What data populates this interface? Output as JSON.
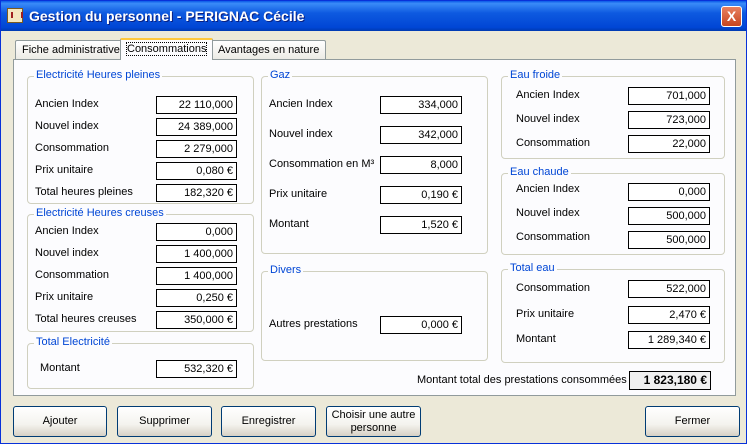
{
  "window": {
    "title": "Gestion du personnel - PERIGNAC Cécile",
    "close_label": "X"
  },
  "tabs": [
    {
      "label": "Fiche administrative"
    },
    {
      "label": "Consommations"
    },
    {
      "label": "Avantages en nature"
    }
  ],
  "hp": {
    "title": "Electricité Heures pleines",
    "ancien_label": "Ancien Index",
    "ancien": "22 110,000",
    "nouvel_label": "Nouvel index",
    "nouvel": "24 389,000",
    "conso_label": "Consommation",
    "conso": "2 279,000",
    "prix_label": "Prix unitaire",
    "prix": "0,080 €",
    "total_label": "Total heures pleines",
    "total": "182,320 €"
  },
  "hc": {
    "title": "Electricité Heures creuses",
    "ancien_label": "Ancien Index",
    "ancien": "0,000",
    "nouvel_label": "Nouvel index",
    "nouvel": "1 400,000",
    "conso_label": "Consommation",
    "conso": "1 400,000",
    "prix_label": "Prix unitaire",
    "prix": "0,250 €",
    "total_label": "Total heures creuses",
    "total": "350,000 €"
  },
  "te": {
    "title": "Total Electricité",
    "montant_label": "Montant",
    "montant": "532,320 €"
  },
  "gaz": {
    "title": "Gaz",
    "ancien_label": "Ancien Index",
    "ancien": "334,000",
    "nouvel_label": "Nouvel index",
    "nouvel": "342,000",
    "conso_label": "Consommation en M³",
    "conso": "8,000",
    "prix_label": "Prix unitaire",
    "prix": "0,190 €",
    "montant_label": "Montant",
    "montant": "1,520 €"
  },
  "divers": {
    "title": "Divers",
    "autres_label": "Autres prestations",
    "autres": "0,000 €"
  },
  "ef": {
    "title": "Eau froide",
    "ancien_label": "Ancien Index",
    "ancien": "701,000",
    "nouvel_label": "Nouvel index",
    "nouvel": "723,000",
    "conso_label": "Consommation",
    "conso": "22,000"
  },
  "ec": {
    "title": "Eau chaude",
    "ancien_label": "Ancien Index",
    "ancien": "0,000",
    "nouvel_label": "Nouvel index",
    "nouvel": "500,000",
    "conso_label": "Consommation",
    "conso": "500,000"
  },
  "tw": {
    "title": "Total eau",
    "conso_label": "Consommation",
    "conso": "522,000",
    "prix_label": "Prix unitaire",
    "prix": "2,470 €",
    "montant_label": "Montant",
    "montant": "1 289,340 €"
  },
  "grand": {
    "label": "Montant total des prestations consommées :",
    "value": "1 823,180 €"
  },
  "buttons": {
    "ajouter": "Ajouter",
    "supprimer": "Supprimer",
    "enregistrer": "Enregistrer",
    "choisir_line1": "Choisir une autre",
    "choisir_line2": "personne",
    "fermer": "Fermer"
  }
}
